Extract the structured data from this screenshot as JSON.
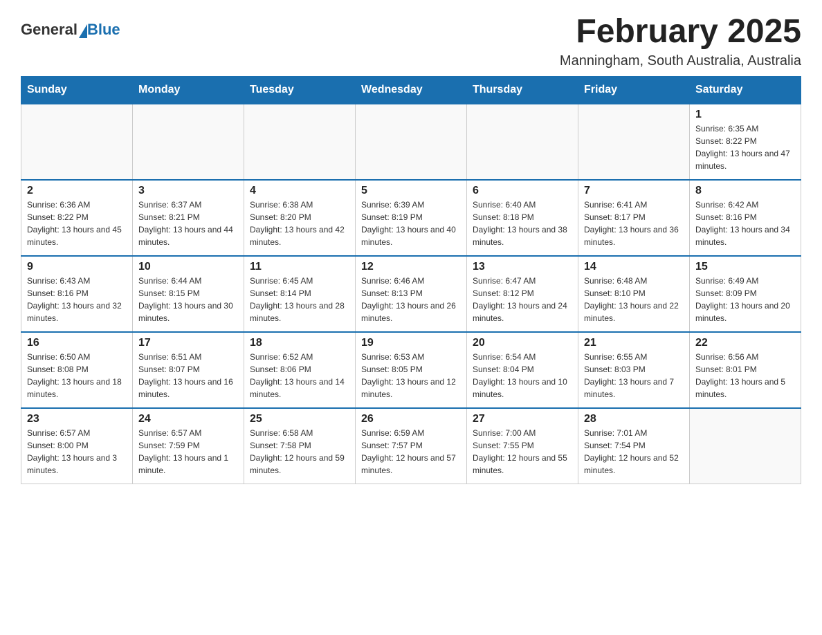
{
  "header": {
    "logo_general": "General",
    "logo_blue": "Blue",
    "month_title": "February 2025",
    "location": "Manningham, South Australia, Australia"
  },
  "days_of_week": [
    "Sunday",
    "Monday",
    "Tuesday",
    "Wednesday",
    "Thursday",
    "Friday",
    "Saturday"
  ],
  "weeks": [
    [
      {
        "day": "",
        "info": ""
      },
      {
        "day": "",
        "info": ""
      },
      {
        "day": "",
        "info": ""
      },
      {
        "day": "",
        "info": ""
      },
      {
        "day": "",
        "info": ""
      },
      {
        "day": "",
        "info": ""
      },
      {
        "day": "1",
        "info": "Sunrise: 6:35 AM\nSunset: 8:22 PM\nDaylight: 13 hours and 47 minutes."
      }
    ],
    [
      {
        "day": "2",
        "info": "Sunrise: 6:36 AM\nSunset: 8:22 PM\nDaylight: 13 hours and 45 minutes."
      },
      {
        "day": "3",
        "info": "Sunrise: 6:37 AM\nSunset: 8:21 PM\nDaylight: 13 hours and 44 minutes."
      },
      {
        "day": "4",
        "info": "Sunrise: 6:38 AM\nSunset: 8:20 PM\nDaylight: 13 hours and 42 minutes."
      },
      {
        "day": "5",
        "info": "Sunrise: 6:39 AM\nSunset: 8:19 PM\nDaylight: 13 hours and 40 minutes."
      },
      {
        "day": "6",
        "info": "Sunrise: 6:40 AM\nSunset: 8:18 PM\nDaylight: 13 hours and 38 minutes."
      },
      {
        "day": "7",
        "info": "Sunrise: 6:41 AM\nSunset: 8:17 PM\nDaylight: 13 hours and 36 minutes."
      },
      {
        "day": "8",
        "info": "Sunrise: 6:42 AM\nSunset: 8:16 PM\nDaylight: 13 hours and 34 minutes."
      }
    ],
    [
      {
        "day": "9",
        "info": "Sunrise: 6:43 AM\nSunset: 8:16 PM\nDaylight: 13 hours and 32 minutes."
      },
      {
        "day": "10",
        "info": "Sunrise: 6:44 AM\nSunset: 8:15 PM\nDaylight: 13 hours and 30 minutes."
      },
      {
        "day": "11",
        "info": "Sunrise: 6:45 AM\nSunset: 8:14 PM\nDaylight: 13 hours and 28 minutes."
      },
      {
        "day": "12",
        "info": "Sunrise: 6:46 AM\nSunset: 8:13 PM\nDaylight: 13 hours and 26 minutes."
      },
      {
        "day": "13",
        "info": "Sunrise: 6:47 AM\nSunset: 8:12 PM\nDaylight: 13 hours and 24 minutes."
      },
      {
        "day": "14",
        "info": "Sunrise: 6:48 AM\nSunset: 8:10 PM\nDaylight: 13 hours and 22 minutes."
      },
      {
        "day": "15",
        "info": "Sunrise: 6:49 AM\nSunset: 8:09 PM\nDaylight: 13 hours and 20 minutes."
      }
    ],
    [
      {
        "day": "16",
        "info": "Sunrise: 6:50 AM\nSunset: 8:08 PM\nDaylight: 13 hours and 18 minutes."
      },
      {
        "day": "17",
        "info": "Sunrise: 6:51 AM\nSunset: 8:07 PM\nDaylight: 13 hours and 16 minutes."
      },
      {
        "day": "18",
        "info": "Sunrise: 6:52 AM\nSunset: 8:06 PM\nDaylight: 13 hours and 14 minutes."
      },
      {
        "day": "19",
        "info": "Sunrise: 6:53 AM\nSunset: 8:05 PM\nDaylight: 13 hours and 12 minutes."
      },
      {
        "day": "20",
        "info": "Sunrise: 6:54 AM\nSunset: 8:04 PM\nDaylight: 13 hours and 10 minutes."
      },
      {
        "day": "21",
        "info": "Sunrise: 6:55 AM\nSunset: 8:03 PM\nDaylight: 13 hours and 7 minutes."
      },
      {
        "day": "22",
        "info": "Sunrise: 6:56 AM\nSunset: 8:01 PM\nDaylight: 13 hours and 5 minutes."
      }
    ],
    [
      {
        "day": "23",
        "info": "Sunrise: 6:57 AM\nSunset: 8:00 PM\nDaylight: 13 hours and 3 minutes."
      },
      {
        "day": "24",
        "info": "Sunrise: 6:57 AM\nSunset: 7:59 PM\nDaylight: 13 hours and 1 minute."
      },
      {
        "day": "25",
        "info": "Sunrise: 6:58 AM\nSunset: 7:58 PM\nDaylight: 12 hours and 59 minutes."
      },
      {
        "day": "26",
        "info": "Sunrise: 6:59 AM\nSunset: 7:57 PM\nDaylight: 12 hours and 57 minutes."
      },
      {
        "day": "27",
        "info": "Sunrise: 7:00 AM\nSunset: 7:55 PM\nDaylight: 12 hours and 55 minutes."
      },
      {
        "day": "28",
        "info": "Sunrise: 7:01 AM\nSunset: 7:54 PM\nDaylight: 12 hours and 52 minutes."
      },
      {
        "day": "",
        "info": ""
      }
    ]
  ]
}
